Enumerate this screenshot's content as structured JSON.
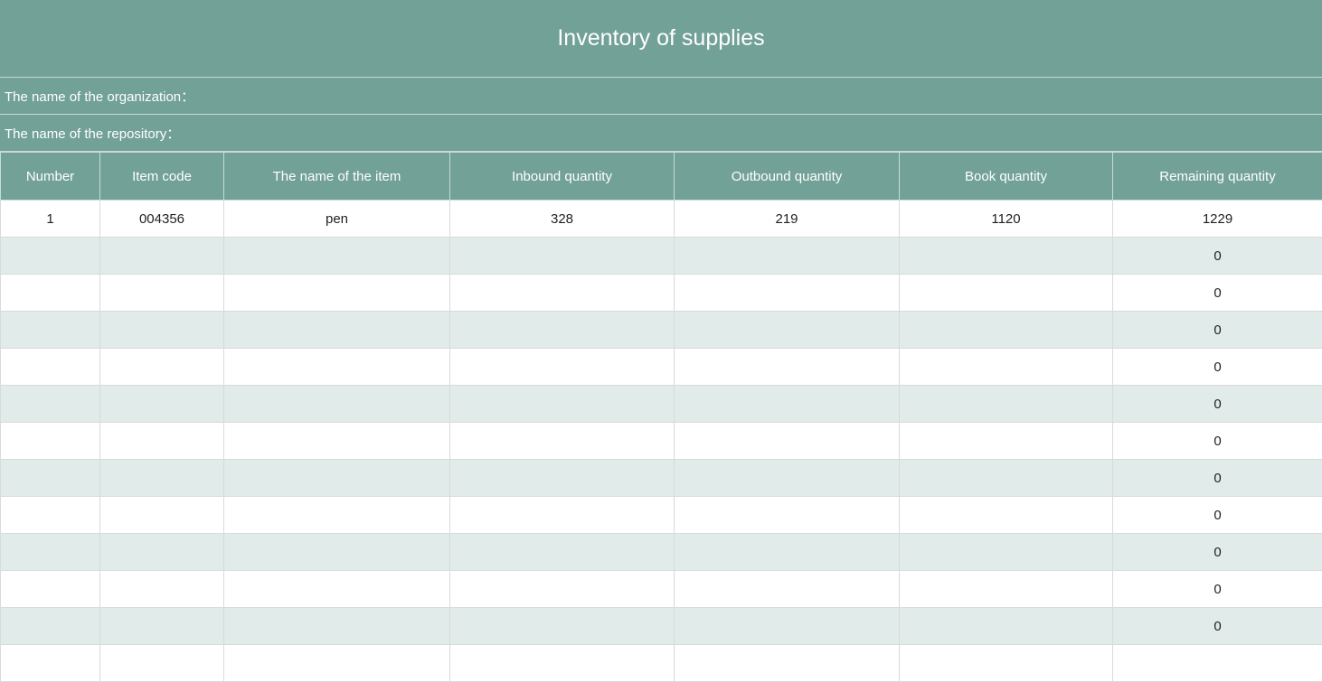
{
  "sheet": {
    "title": "Inventory of supplies",
    "organization_label": "The name of the organization：",
    "repository_label": "The name of the repository："
  },
  "table": {
    "columns": [
      "Number",
      "Item code",
      "The name of the item",
      "Inbound quantity",
      "Outbound quantity",
      "Book quantity",
      "Remaining quantity"
    ],
    "rows": [
      [
        "1",
        "004356",
        "pen",
        "328",
        "219",
        "1120",
        "1229"
      ],
      [
        "",
        "",
        "",
        "",
        "",
        "",
        "0"
      ],
      [
        "",
        "",
        "",
        "",
        "",
        "",
        "0"
      ],
      [
        "",
        "",
        "",
        "",
        "",
        "",
        "0"
      ],
      [
        "",
        "",
        "",
        "",
        "",
        "",
        "0"
      ],
      [
        "",
        "",
        "",
        "",
        "",
        "",
        "0"
      ],
      [
        "",
        "",
        "",
        "",
        "",
        "",
        "0"
      ],
      [
        "",
        "",
        "",
        "",
        "",
        "",
        "0"
      ],
      [
        "",
        "",
        "",
        "",
        "",
        "",
        "0"
      ],
      [
        "",
        "",
        "",
        "",
        "",
        "",
        "0"
      ],
      [
        "",
        "",
        "",
        "",
        "",
        "",
        "0"
      ],
      [
        "",
        "",
        "",
        "",
        "",
        "",
        "0"
      ],
      [
        "",
        "",
        "",
        "",
        "",
        "",
        ""
      ]
    ]
  },
  "colors": {
    "header_bg": "#72a197",
    "header_text": "#ffffff",
    "stripe_bg": "#e1ebe9",
    "grid_line": "#d7dbda"
  }
}
